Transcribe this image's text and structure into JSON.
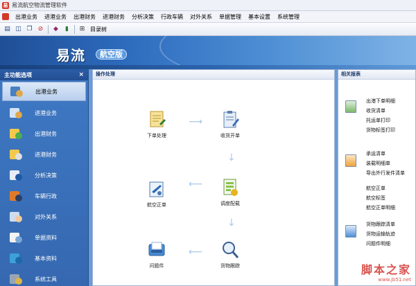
{
  "window": {
    "title": "易流航空物流管理软件"
  },
  "menu": [
    "出港业务",
    "进港业务",
    "出港财务",
    "进港财务",
    "分析决策",
    "行政车辆",
    "对外关系",
    "单据管理",
    "基本设置",
    "系统管理"
  ],
  "toolbar": {
    "label": "目录树"
  },
  "banner": {
    "brand": "易流",
    "sub": "航空版"
  },
  "sidebar": {
    "title": "主功能选项",
    "close": "×",
    "items": [
      {
        "label": "出港业务",
        "icon": "user-desk-icon"
      },
      {
        "label": "进港业务",
        "icon": "user-desk-icon"
      },
      {
        "label": "出港财务",
        "icon": "finance-folder-icon"
      },
      {
        "label": "进港财务",
        "icon": "finance-folder-icon"
      },
      {
        "label": "分析决策",
        "icon": "analysis-icon"
      },
      {
        "label": "车辆行政",
        "icon": "truck-icon"
      },
      {
        "label": "对外关系",
        "icon": "handshake-icon"
      },
      {
        "label": "单据资料",
        "icon": "document-icon"
      },
      {
        "label": "基本资料",
        "icon": "database-icon"
      },
      {
        "label": "系统工具",
        "icon": "tools-icon"
      }
    ]
  },
  "main": {
    "title": "操作处理",
    "nodes": {
      "order": "下单处理",
      "receive": "收货开单",
      "airbill": "航空正单",
      "dispatch": "调度配载",
      "problem": "问题件",
      "tracking": "货物跟踪"
    }
  },
  "related": {
    "title": "相关报表",
    "group1": [
      "出港下单明细",
      "收货清单",
      "托运单打印",
      "货物标签打印"
    ],
    "group2": [
      "承运清单",
      "装载明细单",
      "导出外行发件清单",
      "航空正单",
      "航空标签",
      "航空正单明细"
    ],
    "group3": [
      "货物跟踪清单",
      "货物运输轨迹",
      "问题件明细"
    ]
  },
  "watermark": {
    "main": "脚本之家",
    "sub": "www.jb51.net"
  },
  "colors": {
    "accent": "#3568b0",
    "banner": "#2d6bbd",
    "active": "#dbe8f8"
  }
}
